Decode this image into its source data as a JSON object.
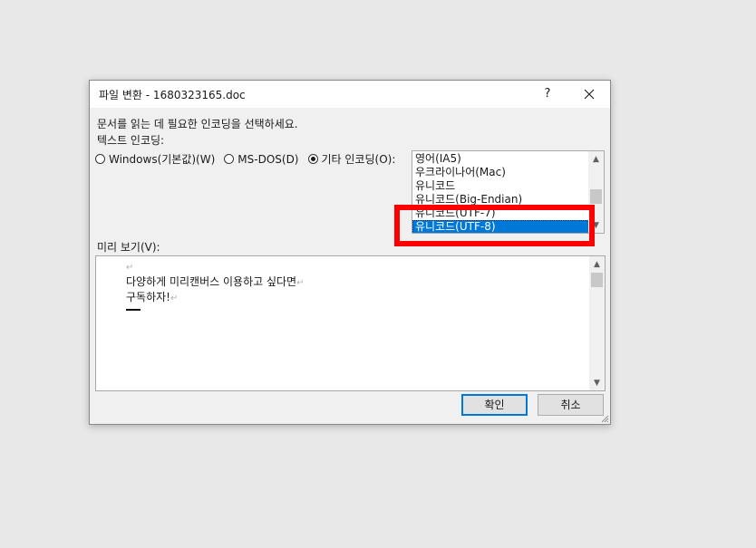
{
  "dialog": {
    "title": "파일 변환 - 1680323165.doc",
    "help_label": "?",
    "instruction": "문서를 읽는 데 필요한 인코딩을 선택하세요.",
    "encoding_label": "텍스트 인코딩:",
    "radio_options": [
      {
        "label": "Windows(기본값)(W)",
        "checked": false
      },
      {
        "label": "MS-DOS(D)",
        "checked": false
      },
      {
        "label": "기타 인코딩(O):",
        "checked": true
      }
    ],
    "encoding_list": {
      "items": [
        "영어(IA5)",
        "우크라이나어(Mac)",
        "유니코드",
        "유니코드(Big-Endian)",
        "유니코드(UTF-7)",
        "유니코드(UTF-8)"
      ],
      "selected": "유니코드(UTF-8)"
    },
    "preview_label": "미리 보기(V):",
    "preview_lines": [
      "다양하게 미리캔버스 이용하고 싶다면",
      "구독하자!"
    ],
    "ok_label": "확인",
    "cancel_label": "취소"
  },
  "colors": {
    "selection": "#0078d7",
    "highlight_box": "#ff0000"
  },
  "icons": {
    "close": "close-icon",
    "scroll_up": "scroll-up-arrow-icon",
    "scroll_down": "scroll-down-arrow-icon",
    "paragraph_mark": "paragraph-mark-icon",
    "resize_grip": "resize-grip-icon"
  }
}
